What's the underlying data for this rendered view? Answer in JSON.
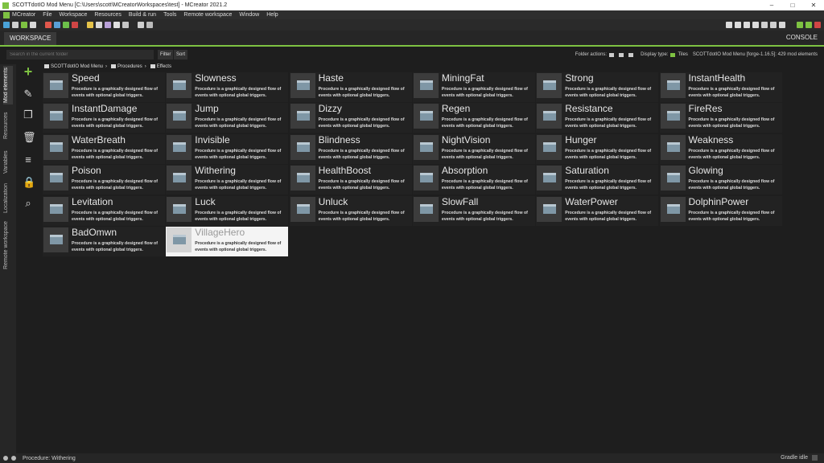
{
  "window": {
    "title": "SCOTTdotIO Mod Menu [C:\\Users\\scott\\MCreatorWorkspaces\\test] - MCreator 2021.2",
    "controls": [
      "–",
      "□",
      "✕"
    ]
  },
  "menu": [
    "MCreator",
    "File",
    "Workspace",
    "Resources",
    "Build & run",
    "Tools",
    "Remote workspace",
    "Window",
    "Help"
  ],
  "tabs": {
    "workspace": "WORKSPACE",
    "console": "CONSOLE"
  },
  "sidebar_tabs": [
    "Mod elements",
    "Resources",
    "Variables",
    "Localization",
    "Remote workspace"
  ],
  "filter": {
    "search_placeholder": "Search in the current folder",
    "filter_label": "Filter",
    "sort_label": "Sort",
    "folder_actions": "Folder actions:",
    "display_type": "Display type:",
    "display_value": "Tiles",
    "workspace_info": "SCOTTdotIO Mod Menu [forge-1.16.5]: 429 mod elements"
  },
  "breadcrumb": [
    "SCOTTdotIO Mod Menu",
    "Procedures",
    "Effects"
  ],
  "tile_description": "Procedure is a graphically designed flow of events with optional global triggers.",
  "elements": [
    "Speed",
    "Slowness",
    "Haste",
    "MiningFat",
    "Strong",
    "InstantHealth",
    "InstantDamage",
    "Jump",
    "Dizzy",
    "Regen",
    "Resistance",
    "FireRes",
    "WaterBreath",
    "Invisible",
    "Blindness",
    "NightVision",
    "Hunger",
    "Weakness",
    "Poison",
    "Withering",
    "HealthBoost",
    "Absorption",
    "Saturation",
    "Glowing",
    "Levitation",
    "Luck",
    "Unluck",
    "SlowFall",
    "WaterPower",
    "DolphinPower",
    "BadOmwn",
    "VillageHero"
  ],
  "selected_element": "VillageHero",
  "status": {
    "text": "Procedure: Withering",
    "gradle": "Gradle idle"
  },
  "colors": {
    "accent": "#7ec242",
    "background": "#1e1e1e",
    "tile": "#222222",
    "selected_tile": "#f4f4f4"
  }
}
